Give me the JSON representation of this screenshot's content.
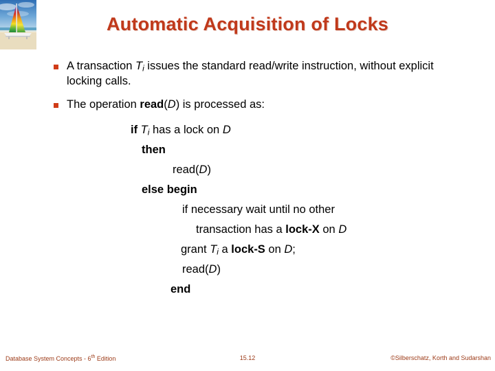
{
  "logo": {
    "icon": "sailboat-photo",
    "description": "Catamaran with rainbow-colored sail on a tropical beach"
  },
  "title": "Automatic Acquisition of Locks",
  "title_color": "#c0391b",
  "bullet_color": "#d03c18",
  "body": {
    "bullets": [
      {
        "marker": "square-bullet",
        "segments": [
          {
            "text": "A transaction ",
            "style": "normal"
          },
          {
            "text": "T",
            "style": "italic"
          },
          {
            "text": "i",
            "style": "subscript"
          },
          {
            "text": " issues the standard read/write instruction, without explicit locking calls.",
            "style": "normal"
          }
        ]
      },
      {
        "marker": "square-bullet",
        "segments": [
          {
            "text": "The operation ",
            "style": "normal"
          },
          {
            "text": "read",
            "style": "bold"
          },
          {
            "text": "(",
            "style": "normal"
          },
          {
            "text": "D",
            "style": "italic"
          },
          {
            "text": ") is processed as:",
            "style": "normal"
          }
        ]
      }
    ],
    "code_lines": [
      {
        "indent": 1,
        "segments": [
          {
            "text": "if ",
            "style": "bold"
          },
          {
            "text": "T",
            "style": "italic"
          },
          {
            "text": "i",
            "style": "subscript"
          },
          {
            "text": " has a lock on ",
            "style": "normal"
          },
          {
            "text": "D",
            "style": "italic"
          }
        ]
      },
      {
        "indent": 2,
        "segments": [
          {
            "text": "then",
            "style": "bold"
          }
        ]
      },
      {
        "indent": 3,
        "segments": [
          {
            "text": "read(",
            "style": "normal"
          },
          {
            "text": "D",
            "style": "italic"
          },
          {
            "text": ")",
            "style": "normal"
          }
        ]
      },
      {
        "indent": 2,
        "segments": [
          {
            "text": "else begin",
            "style": "bold"
          }
        ]
      },
      {
        "indent": 4,
        "segments": [
          {
            "text": "if necessary wait until no other",
            "style": "normal"
          }
        ]
      },
      {
        "indent": 5,
        "segments": [
          {
            "text": "transaction has a ",
            "style": "normal"
          },
          {
            "text": "lock-X",
            "style": "bold"
          },
          {
            "text": " on ",
            "style": "normal"
          },
          {
            "text": "D",
            "style": "italic"
          }
        ]
      },
      {
        "indent": 6,
        "segments": [
          {
            "text": "grant ",
            "style": "normal"
          },
          {
            "text": "T",
            "style": "italic"
          },
          {
            "text": "i",
            "style": "subscript"
          },
          {
            "text": " a  ",
            "style": "normal"
          },
          {
            "text": "lock-S",
            "style": "bold"
          },
          {
            "text": " on ",
            "style": "normal"
          },
          {
            "text": "D",
            "style": "italic"
          },
          {
            "text": ";",
            "style": "normal"
          }
        ]
      },
      {
        "indent": 7,
        "segments": [
          {
            "text": "read(",
            "style": "normal"
          },
          {
            "text": "D",
            "style": "italic"
          },
          {
            "text": ")",
            "style": "normal"
          }
        ]
      },
      {
        "indent": 8,
        "segments": [
          {
            "text": "end",
            "style": "bold"
          }
        ]
      }
    ]
  },
  "footer": {
    "left_text": "Database System Concepts - 6",
    "left_superscript": "th",
    "left_suffix": " Edition",
    "slide_number": "15.12",
    "copyright": "©Silberschatz, Korth and Sudarshan",
    "color": "#9c3a17"
  }
}
